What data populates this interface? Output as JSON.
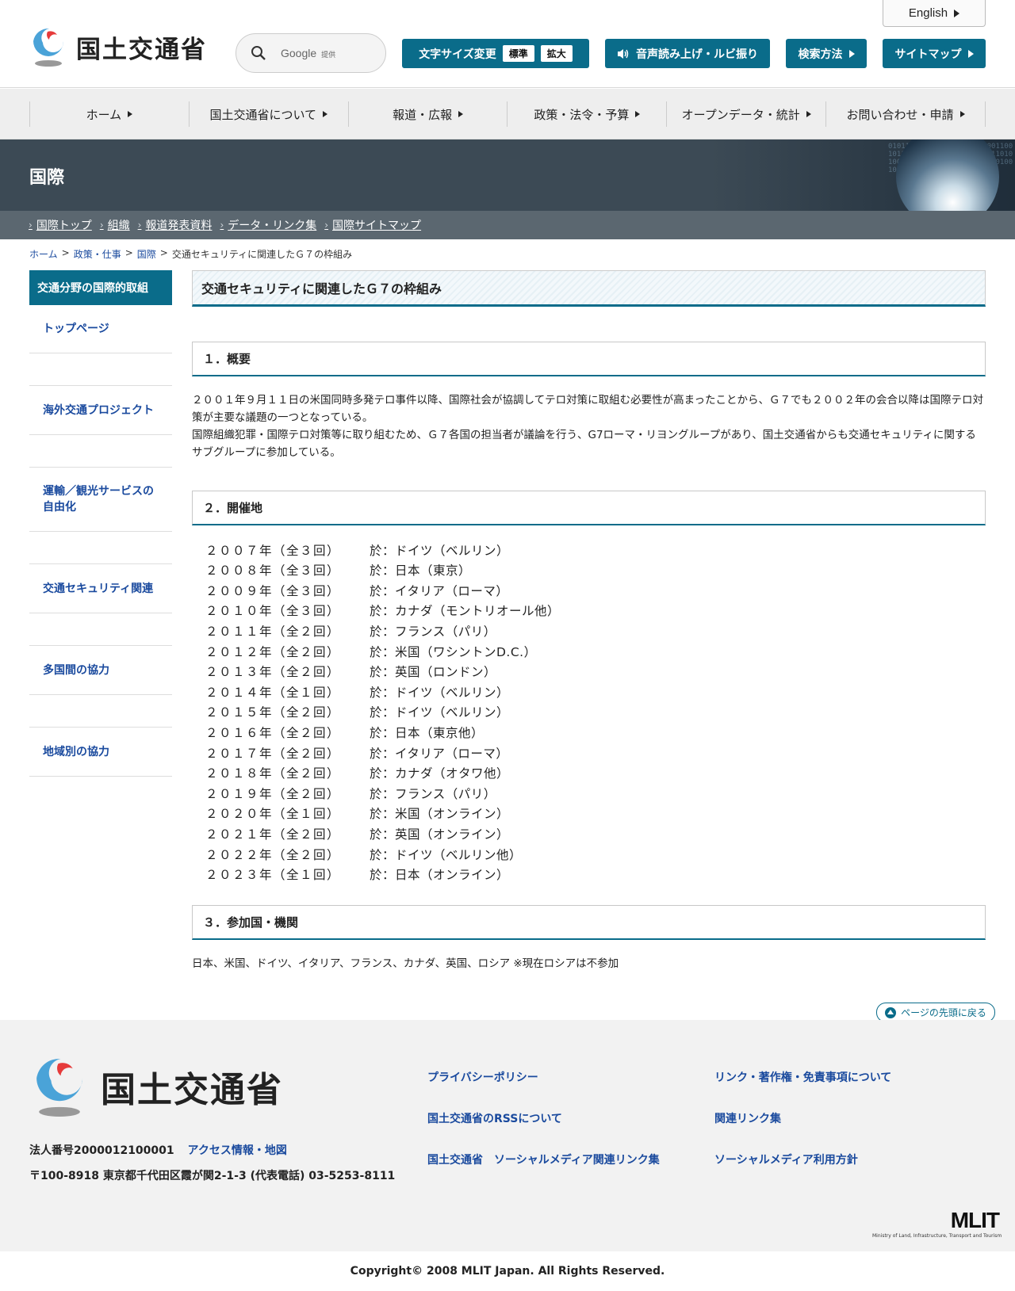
{
  "header": {
    "english_label": "English",
    "logo_text": "国土交通省",
    "search_placeholder": "Google",
    "search_provider": "提供",
    "font_size_label": "文字サイズ変更",
    "font_size_standard": "標準",
    "font_size_large": "拡大",
    "read_aloud_label": "音声読み上げ・ルビ振り",
    "search_method_label": "検索方法",
    "sitemap_label": "サイトマップ",
    "accent_color": "#0a6c8a"
  },
  "global_nav": [
    "ホーム",
    "国土交通省について",
    "報道・広報",
    "政策・法令・予算",
    "オープンデータ・統計",
    "お問い合わせ・申請"
  ],
  "banner": {
    "title": "国際"
  },
  "sub_nav": [
    "国際トップ",
    "組織",
    "報道発表資料",
    "データ・リンク集",
    "国際サイトマップ"
  ],
  "breadcrumb": {
    "items": [
      "ホーム",
      "政策・仕事",
      "国際"
    ],
    "separator": ">",
    "current": "交通セキュリティに関連したＧ７の枠組み"
  },
  "side_nav": {
    "heading": "交通分野の国際的取組",
    "items": [
      "トップページ",
      "海外交通プロジェクト",
      "運輸／観光サービスの自由化",
      "交通セキュリティ関連",
      "多国間の協力",
      "地域別の協力"
    ]
  },
  "main": {
    "title": "交通セキュリティに関連したＧ７の枠組み",
    "section1_heading": "１．概要",
    "section1_p1": "２００１年９月１１日の米国同時多発テロ事件以降、国際社会が協調してテロ対策に取組む必要性が高まったことから、Ｇ７でも２００２年の会合以降は国際テロ対策が主要な議題の一つとなっている。",
    "section1_p2": "国際組織犯罪・国際テロ対策等に取り組むため、Ｇ７各国の担当者が議論を行う、G7ローマ・リヨングループがあり、国土交通省からも交通セキュリティに関するサブグループに参加している。",
    "section2_heading": "２．開催地",
    "venues": [
      {
        "year": "２００７年（全３回）",
        "place": "於：ドイツ（ベルリン）"
      },
      {
        "year": "２００８年（全３回）",
        "place": "於：日本（東京）"
      },
      {
        "year": "２００９年（全３回）",
        "place": "於：イタリア（ローマ）"
      },
      {
        "year": "２０１０年（全３回）",
        "place": "於：カナダ（モントリオール他）"
      },
      {
        "year": "２０１１年（全２回）",
        "place": "於：フランス（パリ）"
      },
      {
        "year": "２０１２年（全２回）",
        "place": "於：米国（ワシントンD.C.）"
      },
      {
        "year": "２０１３年（全２回）",
        "place": "於：英国（ロンドン）"
      },
      {
        "year": "２０１４年（全１回）",
        "place": "於：ドイツ（ベルリン）"
      },
      {
        "year": "２０１５年（全２回）",
        "place": "於：ドイツ（ベルリン）"
      },
      {
        "year": "２０１６年（全２回）",
        "place": "於：日本（東京他）"
      },
      {
        "year": "２０１７年（全２回）",
        "place": "於：イタリア（ローマ）"
      },
      {
        "year": "２０１８年（全２回）",
        "place": "於：カナダ（オタワ他）"
      },
      {
        "year": "２０１９年（全２回）",
        "place": "於：フランス（パリ）"
      },
      {
        "year": "２０２０年（全１回）",
        "place": "於：米国（オンライン）"
      },
      {
        "year": "２０２１年（全２回）",
        "place": "於：英国（オンライン）"
      },
      {
        "year": "２０２２年（全２回）",
        "place": "於：ドイツ（ベルリン他）"
      },
      {
        "year": "２０２３年（全１回）",
        "place": "於：日本（オンライン）"
      }
    ],
    "section3_heading": "３．参加国・機関",
    "section3_text": "日本、米国、ドイツ、イタリア、フランス、カナダ、英国、ロシア ※現在ロシアは不参加"
  },
  "page_top_label": "ページの先頭に戻る",
  "footer": {
    "logo_text": "国土交通省",
    "corp_number": "法人番号2000012100001",
    "access_link": "アクセス情報・地図",
    "address": "〒100-8918 東京都千代田区霞が関2-1-3 (代表電話) 03-5253-8111",
    "links_col1": [
      "プライバシーポリシー",
      "国土交通省のRSSについて",
      "国土交通省　ソーシャルメディア関連リンク集"
    ],
    "links_col2": [
      "リンク・著作権・免責事項について",
      "関連リンク集",
      "ソーシャルメディア利用方針"
    ],
    "mlit_logo": "MLIT",
    "mlit_subtitle": "Ministry of Land, Infrastructure, Transport and Tourism"
  },
  "copyright": "Copyright© 2008 MLIT Japan. All Rights Reserved."
}
